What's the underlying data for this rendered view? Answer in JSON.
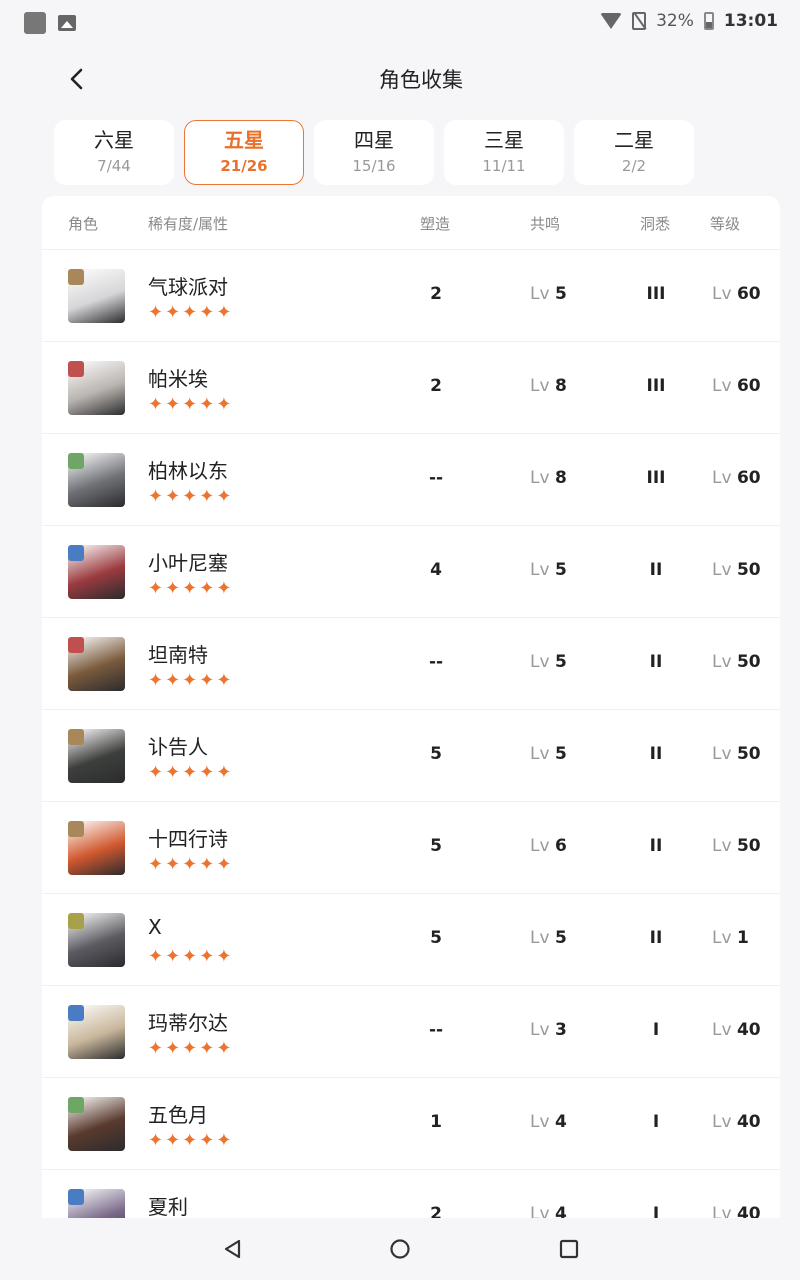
{
  "status_bar": {
    "battery": "32%",
    "time": "13:01"
  },
  "header": {
    "title": "角色收集"
  },
  "tabs": [
    {
      "label": "六星",
      "count": "7/44",
      "active": false
    },
    {
      "label": "五星",
      "count": "21/26",
      "active": true
    },
    {
      "label": "四星",
      "count": "15/16",
      "active": false
    },
    {
      "label": "三星",
      "count": "11/11",
      "active": false
    },
    {
      "label": "二星",
      "count": "2/2",
      "active": false
    }
  ],
  "columns": {
    "role": "角色",
    "rarity": "稀有度/属性",
    "shaping": "塑造",
    "resonance": "共鸣",
    "insight": "洞悉",
    "level": "等级"
  },
  "lv_prefix": "Lv",
  "colors": {
    "accent": "#e8722c",
    "star": "#ea7430"
  },
  "rows": [
    {
      "name": "气球派对",
      "stars": "✦✦✦✦✦",
      "shaping": "2",
      "resonance": "5",
      "insight": "III",
      "level": "60",
      "attr_color": "#a8875a",
      "avatar_color": "#d6d6d8"
    },
    {
      "name": "帕米埃",
      "stars": "✦✦✦✦✦",
      "shaping": "2",
      "resonance": "8",
      "insight": "III",
      "level": "60",
      "attr_color": "#c0504d",
      "avatar_color": "#b9b4b0"
    },
    {
      "name": "柏林以东",
      "stars": "✦✦✦✦✦",
      "shaping": "--",
      "resonance": "8",
      "insight": "III",
      "level": "60",
      "attr_color": "#6ea665",
      "avatar_color": "#6f7176"
    },
    {
      "name": "小叶尼塞",
      "stars": "✦✦✦✦✦",
      "shaping": "4",
      "resonance": "5",
      "insight": "II",
      "level": "50",
      "attr_color": "#4a7cc4",
      "avatar_color": "#9b3b3f"
    },
    {
      "name": "坦南特",
      "stars": "✦✦✦✦✦",
      "shaping": "--",
      "resonance": "5",
      "insight": "II",
      "level": "50",
      "attr_color": "#c0504d",
      "avatar_color": "#7a5a3c"
    },
    {
      "name": "讣告人",
      "stars": "✦✦✦✦✦",
      "shaping": "5",
      "resonance": "5",
      "insight": "II",
      "level": "50",
      "attr_color": "#a8875a",
      "avatar_color": "#3d3f3c"
    },
    {
      "name": "十四行诗",
      "stars": "✦✦✦✦✦",
      "shaping": "5",
      "resonance": "6",
      "insight": "II",
      "level": "50",
      "attr_color": "#a8875a",
      "avatar_color": "#d0582e"
    },
    {
      "name": "X",
      "stars": "✦✦✦✦✦",
      "shaping": "5",
      "resonance": "5",
      "insight": "II",
      "level": "1",
      "attr_color": "#a7a24a",
      "avatar_color": "#5b5b62"
    },
    {
      "name": "玛蒂尔达",
      "stars": "✦✦✦✦✦",
      "shaping": "--",
      "resonance": "3",
      "insight": "I",
      "level": "40",
      "attr_color": "#4a7cc4",
      "avatar_color": "#c9b79c"
    },
    {
      "name": "五色月",
      "stars": "✦✦✦✦✦",
      "shaping": "1",
      "resonance": "4",
      "insight": "I",
      "level": "40",
      "attr_color": "#6ea665",
      "avatar_color": "#5a3a2e"
    },
    {
      "name": "夏利",
      "stars": "✦✦✦✦✦",
      "shaping": "2",
      "resonance": "4",
      "insight": "I",
      "level": "40",
      "attr_color": "#4a7cc4",
      "avatar_color": "#7a6a8a"
    }
  ]
}
